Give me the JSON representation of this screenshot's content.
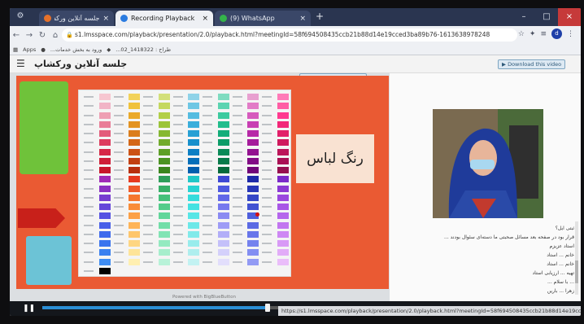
{
  "browser": {
    "tabs": [
      {
        "label": "جلسه آنلاین ورکشاپ",
        "close": "×",
        "active": false,
        "color": "#e6712a"
      },
      {
        "label": "Recording Playback",
        "close": "×",
        "active": true,
        "color": "#2a7be0"
      },
      {
        "label": "(9) WhatsApp",
        "close": "×",
        "active": false,
        "color": "#34b34a"
      }
    ],
    "new_tab": "+",
    "window_controls": {
      "minimize": "–",
      "maximize": "□",
      "close": "×"
    },
    "url": "s1.lmsspace.com/playback/presentation/2.0/playback.html?meetingId=58f694508435ccb21b88d14e19cced3ba89b76-1613638978248",
    "profile_initial": "d",
    "bookmarks": {
      "apps_label": "Apps",
      "item1": "ورود به بخش خدمات...",
      "item2": "...02_1418322 : طراح"
    }
  },
  "page": {
    "session_title": "جلسه آنلاین ورکشاپ",
    "download_video": "Download this video",
    "slide_title": "رنگ لباس",
    "swatch_colors": [
      "#f7c6d0",
      "#f2d25a",
      "#d3e07a",
      "#8fd3e8",
      "#7fdcc0",
      "#e8a0d0",
      "#ff7ab8",
      "#f1b4c6",
      "#f0c23c",
      "#c4d860",
      "#6ec7e4",
      "#5cd4b1",
      "#e27cc7",
      "#ff5ea5",
      "#ee9fb3",
      "#eaa92a",
      "#b2cf48",
      "#55bce0",
      "#3dca9f",
      "#d65bbd",
      "#ff3a8f",
      "#e97e98",
      "#e39322",
      "#9bc43a",
      "#3aaedb",
      "#22bd8c",
      "#c83fb3",
      "#f22879",
      "#e35b7a",
      "#db7d1c",
      "#86b832",
      "#27a0d4",
      "#13ad7a",
      "#b72aa7",
      "#e2206a",
      "#dd3c5e",
      "#d46616",
      "#72ab2c",
      "#1790cc",
      "#0c9c68",
      "#a51c9b",
      "#cf1a5e",
      "#d62847",
      "#cc5214",
      "#5e9f26",
      "#0b7fc4",
      "#0a8a58",
      "#931290",
      "#bc155a",
      "#cf1e38",
      "#c24012",
      "#4b9322",
      "#066fb9",
      "#087a4a",
      "#820c86",
      "#a91055",
      "#c8162c",
      "#b8300f",
      "#3a861e",
      "#035fae",
      "#066a3c",
      "#710679",
      "#971050",
      "#9f2ab7",
      "#e63a20",
      "#2e9e5a",
      "#22c7c7",
      "#3e48d4",
      "#1e2aa8",
      "#7b2ac9",
      "#8b30c2",
      "#ef5a2a",
      "#38b068",
      "#2ad3d3",
      "#4f5ae0",
      "#2837b8",
      "#8b3ad4",
      "#773cd0",
      "#f5762e",
      "#45c07a",
      "#35dcdc",
      "#6268e8",
      "#3446c6",
      "#9a48de",
      "#6446da",
      "#f98c38",
      "#53cc8a",
      "#45e2e2",
      "#7678ee",
      "#4152d2",
      "#a856e6",
      "#5552e2",
      "#fca046",
      "#62d69a",
      "#58e6e6",
      "#8a8af2",
      "#4e5edc",
      "#b566ec",
      "#4960e8",
      "#feb458",
      "#72dea8",
      "#6ce8e8",
      "#9e9cf6",
      "#5b6ae4",
      "#c276f0",
      "#3f6aec",
      "#fec66c",
      "#82e4b4",
      "#82eaea",
      "#b2aef8",
      "#6876ea",
      "#ce88f4",
      "#3a74ee",
      "#fed682",
      "#94eac0",
      "#98ecec",
      "#c4c0fa",
      "#7582ee",
      "#d89af6",
      "#3a80f0",
      "#fee498",
      "#a6eecc",
      "#aeeeee",
      "#d4d0fb",
      "#838ef2",
      "#e2acf8",
      "#3e8cf2",
      "#ffefb0",
      "#b8f2d8",
      "#c2f2f2",
      "#e2defc",
      "#929af4",
      "#eabdfa",
      "#000000"
    ],
    "chat": [
      "ثبتی ایل؟",
      "قرار بود در صفحه بعد مسائل صحبتی ما دسته‌ای سئوال بودند ...",
      "استاد عزیزم",
      "خانم ... استاد",
      "خانم ... استاد",
      "تهیه ... ارزیابی استاد",
      "... با سلام ...",
      "زهرا ... باریں"
    ],
    "powered_by": "Powered with BigBlueButton"
  },
  "player": {
    "play_icon": "pause",
    "play_glyph": "❚❚",
    "progress_fraction": 0.42,
    "status_url": "https://s1.lmsspace.com/playback/presentation/2.0/playback.html?meetingId=58f694508435ccb21b88d14e19cced3ba89b76-1613638978248"
  }
}
